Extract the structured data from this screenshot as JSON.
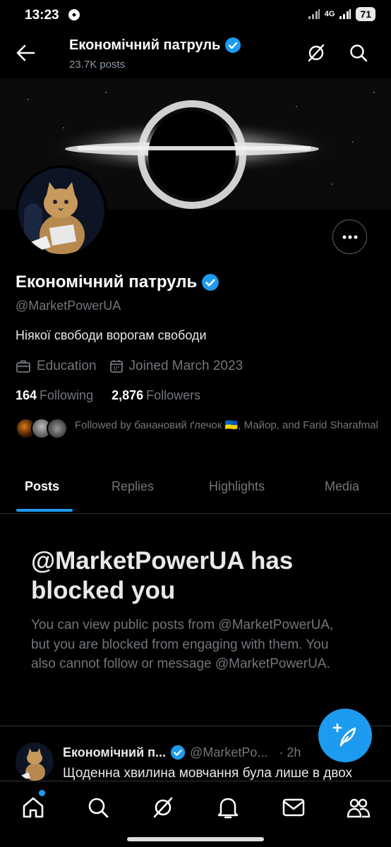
{
  "status": {
    "time": "13:23",
    "network": "4G",
    "battery": "71"
  },
  "header": {
    "title": "Економічний патруль",
    "posts_count": "23.7K posts"
  },
  "profile": {
    "name": "Економічний патруль",
    "handle": "@MarketPowerUA",
    "bio": "Ніякої свободи ворогам свободи",
    "category": "Education",
    "joined": "Joined March 2023",
    "following_count": "164",
    "following_label": "Following",
    "followers_count": "2,876",
    "followers_label": "Followers",
    "followed_by": "Followed by банановий ґлечок 🇺🇦, Майор, and Farid Sharafmal"
  },
  "tabs": [
    "Posts",
    "Replies",
    "Highlights",
    "Media"
  ],
  "blocked": {
    "title": "@MarketPowerUA has blocked you",
    "body": "You can view public posts from @MarketPowerUA, but you are blocked from engaging with them. You also cannot follow or message @MarketPowerUA."
  },
  "tweet": {
    "name": "Економічний п...",
    "handle": "@MarketPo...",
    "time": "· 2h",
    "text": "Щоденна хвилина мовчання була лише в двох"
  },
  "colors": {
    "accent": "#1d9bf0",
    "background": "#000000",
    "muted": "#71767b"
  },
  "icons": {
    "header": [
      "back-arrow-icon",
      "grok-icon",
      "search-icon"
    ],
    "nav": [
      "home-icon",
      "search-icon",
      "grok-icon",
      "notifications-icon",
      "messages-icon",
      "communities-icon"
    ]
  }
}
